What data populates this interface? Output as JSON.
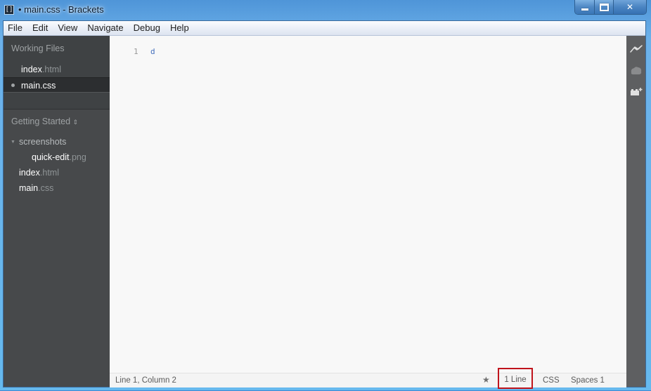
{
  "window": {
    "title": "• main.css - Brackets",
    "app_icon": "brackets-logo-icon",
    "controls": {
      "minimize": "minimize-icon",
      "maximize": "maximize-icon",
      "close": "✕"
    }
  },
  "menubar": {
    "items": [
      "File",
      "Edit",
      "View",
      "Navigate",
      "Debug",
      "Help"
    ]
  },
  "sidebar": {
    "working_files_header": "Working Files",
    "working_files": [
      {
        "base": "index",
        "ext": ".html",
        "dirty": false,
        "selected": false
      },
      {
        "base": "main.css",
        "ext": "",
        "dirty": true,
        "selected": true
      }
    ],
    "project_header": "Getting Started",
    "project_toggle_icon": "⇕",
    "tree": [
      {
        "type": "folder",
        "name": "screenshots",
        "expanded": true
      },
      {
        "type": "file",
        "base": "quick-edit",
        "ext": ".png",
        "depth": 1
      },
      {
        "type": "file",
        "base": "index",
        "ext": ".html",
        "depth": 0
      },
      {
        "type": "file",
        "base": "main",
        "ext": ".css",
        "depth": 0
      }
    ]
  },
  "editor": {
    "lines": [
      {
        "number": "1",
        "text": "d"
      }
    ],
    "colors": {
      "code": "#446fbd",
      "gutter": "#999999"
    }
  },
  "statusbar": {
    "cursor": "Line 1, Column 2",
    "star": "★",
    "line_count": "1 Line",
    "language": "CSS",
    "indent": "Spaces 1",
    "highlight_color": "#c0141c"
  },
  "right_toolbar": {
    "icons": [
      "live-preview-icon",
      "extract-icon",
      "extension-manager-icon"
    ]
  }
}
